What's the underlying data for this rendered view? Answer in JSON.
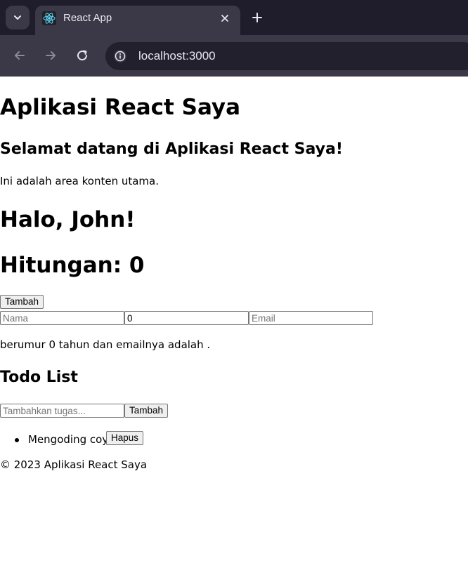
{
  "browser": {
    "tab_title": "React App",
    "url": "localhost:3000",
    "favicon": "react-logo-icon"
  },
  "app": {
    "title": "Aplikasi React Saya",
    "welcome_heading": "Selamat datang di Aplikasi React Saya!",
    "main_text": "Ini adalah area konten utama.",
    "greeting": "Halo, John!",
    "counter_text": "Hitungan: 0",
    "add_button": "Tambah",
    "form": {
      "name_placeholder": "Nama",
      "name_value": "",
      "age_value": "0",
      "email_placeholder": "Email",
      "email_value": ""
    },
    "summary": "berumur 0 tahun dan emailnya adalah ."
  },
  "todo": {
    "heading": "Todo List",
    "input_placeholder": "Tambahkan tugas...",
    "add_button": "Tambah",
    "items": [
      {
        "text": "Mengoding coy",
        "delete_label": "Hapus"
      }
    ]
  },
  "footer": {
    "text": "© 2023 Aplikasi React Saya"
  }
}
